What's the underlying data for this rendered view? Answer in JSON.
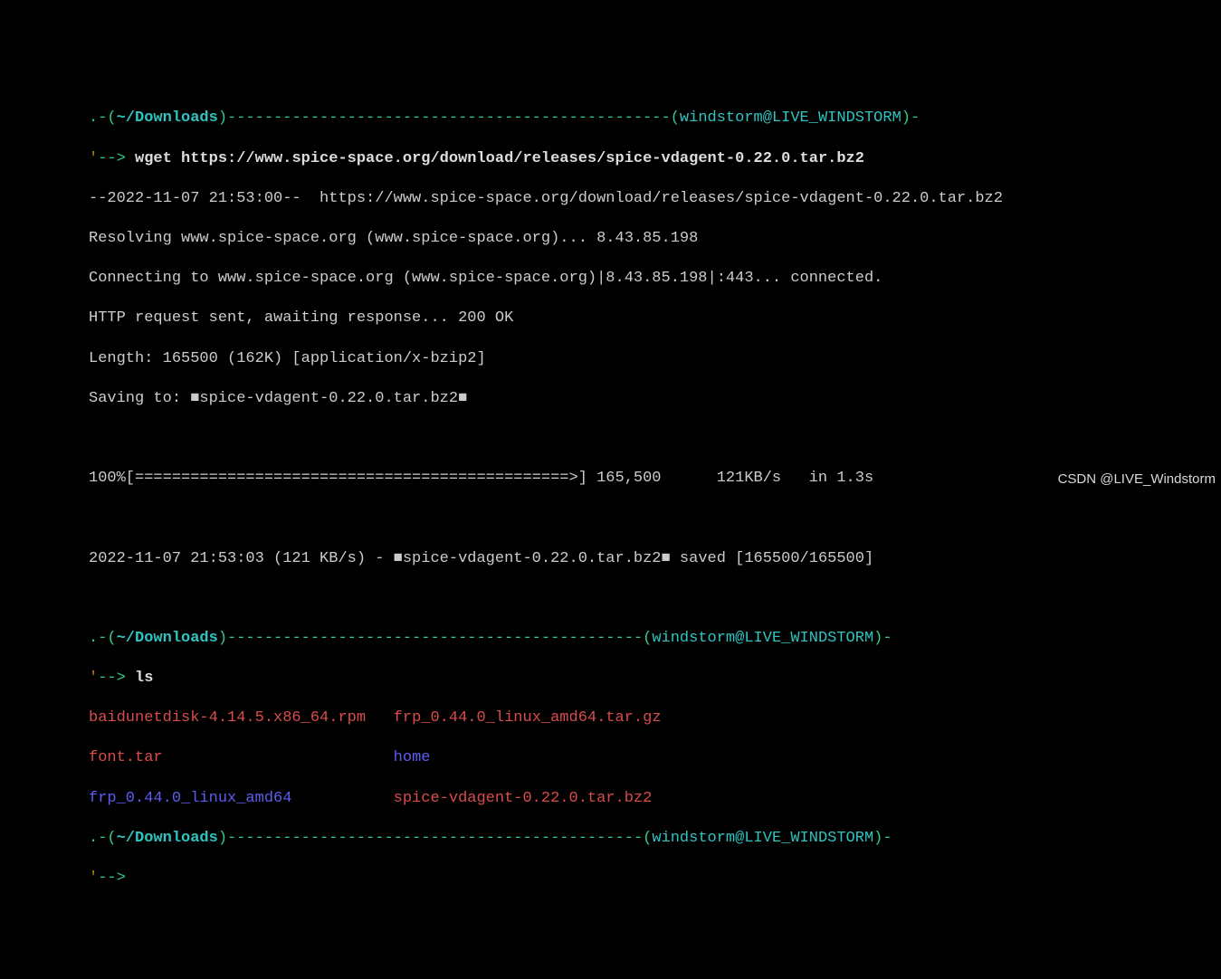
{
  "prompt": {
    "dot": ".",
    "dash_open": "-(",
    "path": "~/Downloads",
    "close_dash": ")",
    "fill1": "------------------------------------------------",
    "fill2": "---------------------------------------------",
    "open_user": "(",
    "user": "windstorm",
    "at": "@",
    "host": "LIVE_WINDSTORM",
    "close_user": ")-",
    "arrow_quote": "'",
    "arrow": "--> "
  },
  "cmd1": "wget https://www.spice-space.org/download/releases/spice-vdagent-0.22.0.tar.bz2",
  "wget": {
    "l1": "--2022-11-07 21:53:00--  https://www.spice-space.org/download/releases/spice-vdagent-0.22.0.tar.bz2",
    "l2": "Resolving www.spice-space.org (www.spice-space.org)... 8.43.85.198",
    "l3": "Connecting to www.spice-space.org (www.spice-space.org)|8.43.85.198|:443... connected.",
    "l4": "HTTP request sent, awaiting response... 200 OK",
    "l5": "Length: 165500 (162K) [application/x-bzip2]",
    "l6a": "Saving to: ",
    "l6b": "■spice-vdagent-0.22.0.tar.bz2■",
    "progress": "100%[===============================================>] 165,500      121KB/s   in 1.3s",
    "l7a": "2022-11-07 21:53:03 (121 KB/s) - ",
    "l7b": "■spice-vdagent-0.22.0.tar.bz2■",
    "l7c": " saved [165500/165500]"
  },
  "cmd2": "ls",
  "ls": {
    "r1c1": "baidunetdisk-4.14.5.x86_64.rpm",
    "pad1": "   ",
    "r1c2": "frp_0.44.0_linux_amd64.tar.gz",
    "r2c1": "font.tar",
    "pad2": "                         ",
    "r2c2": "home",
    "r3c1": "frp_0.44.0_linux_amd64",
    "pad3": "           ",
    "r3c2": "spice-vdagent-0.22.0.tar.bz2"
  },
  "watermark": "CSDN @LIVE_Windstorm"
}
